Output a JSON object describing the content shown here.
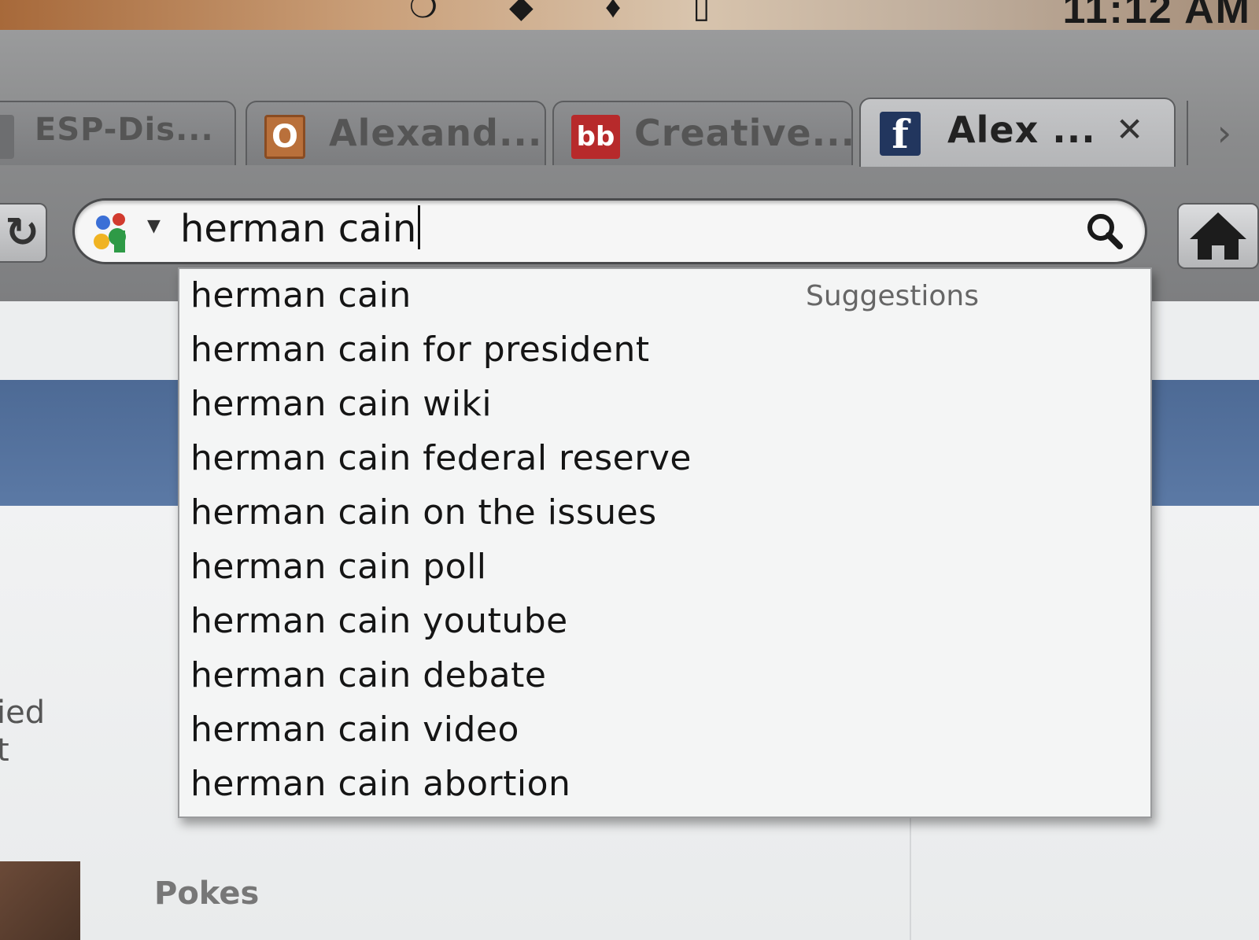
{
  "menubar": {
    "clock": "11:12 AM"
  },
  "tabs": [
    {
      "label": "ESP-Dis...",
      "favicon": "document-icon",
      "active": false
    },
    {
      "label": "Alexand...",
      "favicon": "o-icon",
      "favicon_text": "O",
      "active": false
    },
    {
      "label": "Creative...",
      "favicon": "bb-icon",
      "favicon_text": "bb",
      "active": false
    },
    {
      "label": "Alex ...",
      "favicon": "facebook-icon",
      "favicon_text": "f",
      "active": true
    }
  ],
  "tab_close_symbol": "✕",
  "tab_scroll_symbol": "›",
  "search": {
    "engine": "google-icon",
    "value": "herman cain"
  },
  "dropdown": {
    "heading": "Suggestions",
    "items": [
      "herman cain",
      "herman cain for president",
      "herman cain wiki",
      "herman cain federal reserve",
      "herman cain on the issues",
      "herman cain poll",
      "herman cain youtube",
      "herman cain debate",
      "herman cain video",
      "herman cain abortion"
    ]
  },
  "page": {
    "side_fragment_1": "ied",
    "side_fragment_2": "t",
    "pokes_label": "Pokes"
  },
  "colors": {
    "facebook_blue": "#3b5998",
    "bb_red": "#c8262b",
    "o_orange": "#e6772e"
  }
}
